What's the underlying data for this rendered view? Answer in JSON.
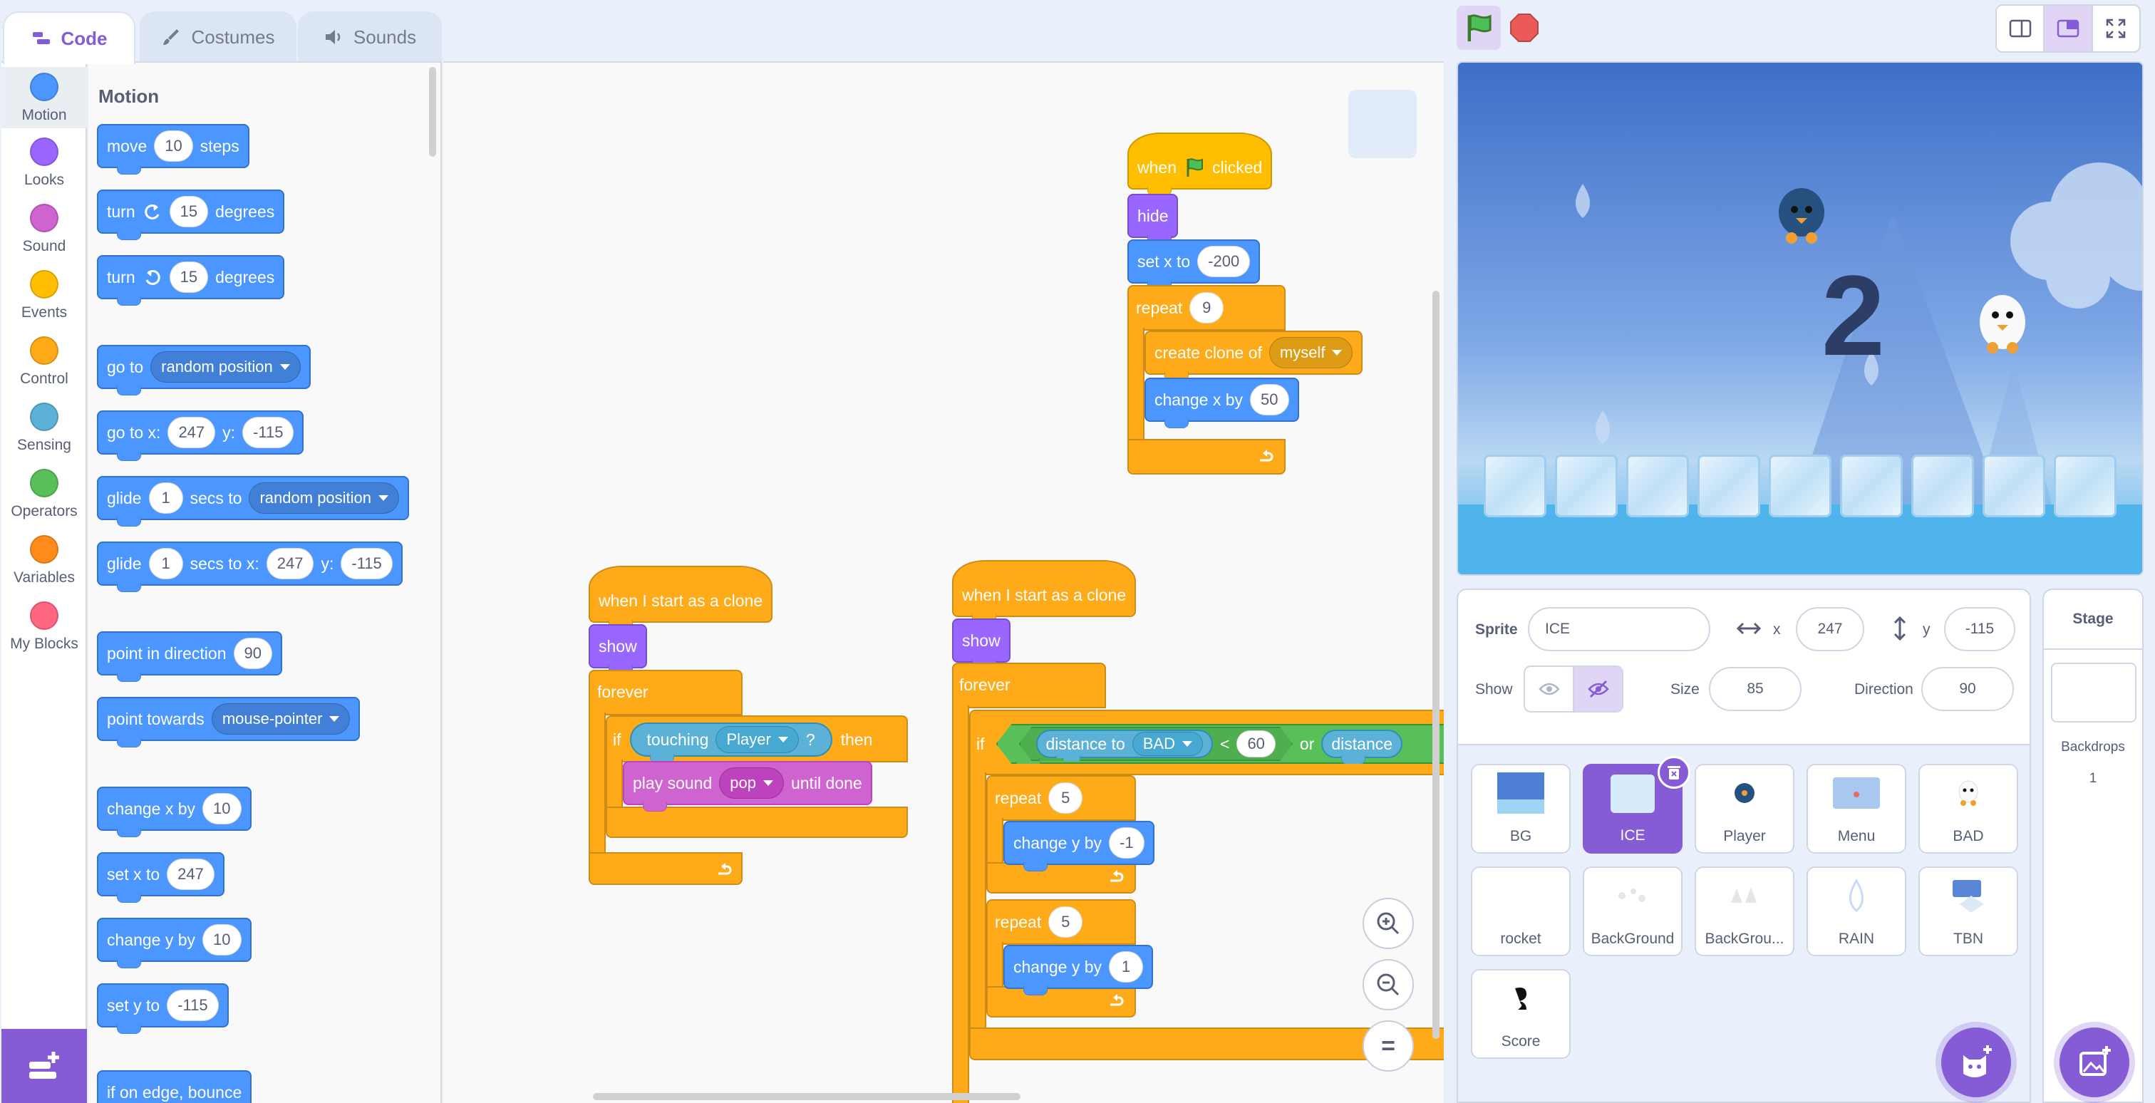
{
  "tabs": {
    "code": "Code",
    "costumes": "Costumes",
    "sounds": "Sounds"
  },
  "categories": [
    {
      "label": "Motion",
      "color": "#4c97ff"
    },
    {
      "label": "Looks",
      "color": "#9966ff"
    },
    {
      "label": "Sound",
      "color": "#cf63cf"
    },
    {
      "label": "Events",
      "color": "#ffbf00"
    },
    {
      "label": "Control",
      "color": "#ffab19"
    },
    {
      "label": "Sensing",
      "color": "#5cb1d6"
    },
    {
      "label": "Operators",
      "color": "#59c059"
    },
    {
      "label": "Variables",
      "color": "#ff8c1a"
    },
    {
      "label": "My Blocks",
      "color": "#ff6680"
    }
  ],
  "palette": {
    "title": "Motion",
    "move": {
      "a": "move",
      "n": "10",
      "b": "steps"
    },
    "turn_right": {
      "a": "turn",
      "n": "15",
      "b": "degrees"
    },
    "turn_left": {
      "a": "turn",
      "n": "15",
      "b": "degrees"
    },
    "goto": {
      "a": "go to",
      "menu": "random position"
    },
    "gotoxy": {
      "a": "go to x:",
      "x": "247",
      "b": "y:",
      "y": "-115"
    },
    "glide": {
      "a": "glide",
      "n": "1",
      "b": "secs to",
      "menu": "random position"
    },
    "glidexy": {
      "a": "glide",
      "n": "1",
      "b": "secs to x:",
      "x": "247",
      "c": "y:",
      "y": "-115"
    },
    "point_dir": {
      "a": "point in direction",
      "n": "90"
    },
    "point_towards": {
      "a": "point towards",
      "menu": "mouse-pointer"
    },
    "change_x": {
      "a": "change x by",
      "n": "10"
    },
    "set_x": {
      "a": "set x to",
      "n": "247"
    },
    "change_y": {
      "a": "change y by",
      "n": "10"
    },
    "set_y": {
      "a": "set y to",
      "n": "-115"
    },
    "bounce": {
      "a": "if on edge, bounce"
    }
  },
  "script1": {
    "when": "when",
    "clicked": "clicked",
    "hide": "hide",
    "setx": "set x to",
    "setx_v": "-200",
    "repeat": "repeat",
    "repeat_v": "9",
    "clone": "create clone of",
    "clone_v": "myself",
    "changex": "change x by",
    "changex_v": "50"
  },
  "script2": {
    "hat": "when I start as a clone",
    "show": "show",
    "forever": "forever",
    "if": "if",
    "touching": "touching",
    "touching_v": "Player",
    "q": "?",
    "then": "then",
    "play": "play sound",
    "play_v": "pop",
    "until": "until done"
  },
  "script3": {
    "hat": "when I start as a clone",
    "show": "show",
    "forever": "forever",
    "if": "if",
    "dist": "distance to",
    "dist_v": "BAD",
    "lt": "<",
    "lt_v": "60",
    "or": "or",
    "dist2": "distance",
    "repeat1": "repeat",
    "repeat1_v": "5",
    "changey1": "change y by",
    "changey1_v": "-1",
    "repeat2": "repeat",
    "repeat2_v": "5",
    "changey2": "change y by",
    "changey2_v": "1"
  },
  "zoom": {
    "reset": "="
  },
  "stage": {
    "score_digit": "2"
  },
  "sprite_info": {
    "sprite_label": "Sprite",
    "sprite_name": "ICE",
    "x_label": "x",
    "x": "247",
    "y_label": "y",
    "y": "-115",
    "show_label": "Show",
    "size_label": "Size",
    "size": "85",
    "direction_label": "Direction",
    "direction": "90"
  },
  "sprites": [
    "BG",
    "ICE",
    "Player",
    "Menu",
    "BAD",
    "rocket",
    "BackGround",
    "BackGrou...",
    "RAIN",
    "TBN",
    "Score"
  ],
  "stage_panel": {
    "title": "Stage",
    "backdrops_label": "Backdrops",
    "backdrops_count": "1"
  },
  "colors": {
    "accent": "#855cd6",
    "motion": "#4c97ff",
    "control": "#ffab19",
    "looks": "#9966ff"
  }
}
